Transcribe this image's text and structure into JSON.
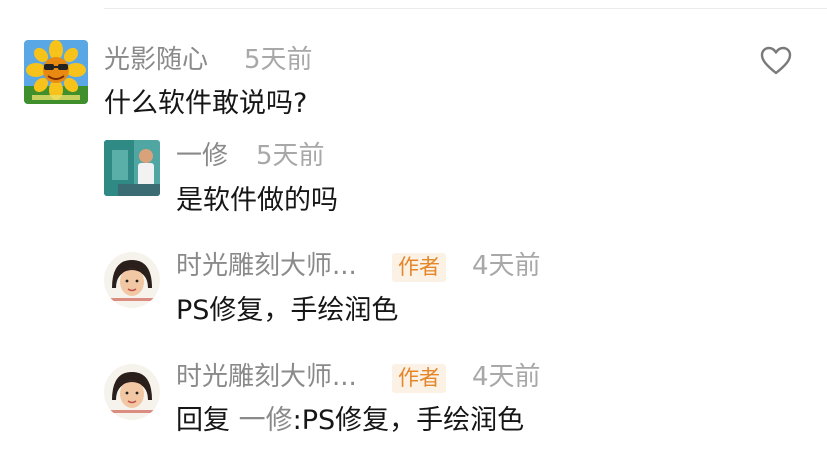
{
  "comments": [
    {
      "author": "光影随心",
      "time": "5天前",
      "text": "什么软件敢说吗?",
      "avatar_icon": "sunflower-avatar"
    }
  ],
  "replies": [
    {
      "author": "一修",
      "time": "5天前",
      "text": "是软件做的吗",
      "avatar_icon": "photo-avatar"
    },
    {
      "author": "时光雕刻大师...",
      "badge": "作者",
      "time": "4天前",
      "text": "PS修复，手绘润色",
      "avatar_icon": "portrait-avatar"
    },
    {
      "author": "时光雕刻大师...",
      "badge": "作者",
      "time": "4天前",
      "reply_prefix": "回复 ",
      "reply_to": "一修",
      "text": ":PS修复，手绘润色",
      "avatar_icon": "portrait-avatar"
    }
  ],
  "colors": {
    "author_name": "#8a8a8a",
    "timestamp": "#a8a8a8",
    "body_text": "#161616",
    "badge_bg": "#fbf1e5",
    "badge_text": "#e4862a"
  },
  "like_icon": "heart-outline-icon"
}
